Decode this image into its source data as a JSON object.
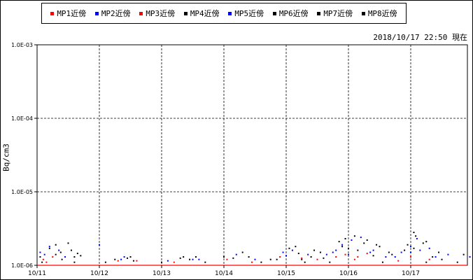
{
  "legend": [
    {
      "label": "MP1近傍",
      "color": "#ff0000"
    },
    {
      "label": "MP2近傍",
      "color": "#0000ff"
    },
    {
      "label": "MP3近傍",
      "color": "#ff0000"
    },
    {
      "label": "MP4近傍",
      "color": "#000000"
    },
    {
      "label": "MP5近傍",
      "color": "#0000ff"
    },
    {
      "label": "MP6近傍",
      "color": "#000000"
    },
    {
      "label": "MP7近傍",
      "color": "#000000"
    },
    {
      "label": "MP8近傍",
      "color": "#000000"
    }
  ],
  "timestamp": "2018/10/17 22:50 現在",
  "chart_data": {
    "type": "scatter",
    "ylabel": "Bq/cm3",
    "yscale": "log",
    "ylim": [
      1e-06,
      0.001
    ],
    "y_tick_labels": [
      "1.0E-03",
      "1.0E-04",
      "1.0E-05",
      "1.0E-06"
    ],
    "x_tick_labels": [
      "10/11",
      "10/12",
      "10/13",
      "10/14",
      "10/15",
      "10/16",
      "10/17"
    ],
    "xlim_days": [
      0,
      7.0
    ],
    "grid": true,
    "baseline_color": "#ff0000",
    "series": [
      {
        "name": "MP1近傍",
        "color": "#ff0000",
        "points": [
          [
            0.1,
            1.2e-06
          ],
          [
            0.25,
            1.3e-06
          ],
          [
            1.3,
            1.15e-06
          ],
          [
            2.2,
            1.1e-06
          ],
          [
            3.05,
            1.2e-06
          ],
          [
            3.9,
            1.3e-06
          ],
          [
            4.25,
            1.25e-06
          ],
          [
            4.8,
            1.3e-06
          ],
          [
            4.95,
            1.4e-06
          ],
          [
            5.15,
            1.3e-06
          ],
          [
            5.3,
            1.45e-06
          ],
          [
            6.0,
            1.3e-06
          ],
          [
            6.3,
            1.2e-06
          ]
        ]
      },
      {
        "name": "MP2近傍",
        "color": "#0000ff",
        "points": [
          [
            0.05,
            1.5e-06
          ],
          [
            0.2,
            1.8e-06
          ],
          [
            0.35,
            1.6e-06
          ],
          [
            1.0,
            1.9e-06
          ],
          [
            1.4,
            1.3e-06
          ],
          [
            2.5,
            1.2e-06
          ],
          [
            3.2,
            1.4e-06
          ],
          [
            3.95,
            1.5e-06
          ],
          [
            4.1,
            1.6e-06
          ],
          [
            4.35,
            1.4e-06
          ],
          [
            4.75,
            1.5e-06
          ],
          [
            4.9,
            1.9e-06
          ],
          [
            5.05,
            2.2e-06
          ],
          [
            5.2,
            2.4e-06
          ],
          [
            5.4,
            1.6e-06
          ],
          [
            5.6,
            1.3e-06
          ],
          [
            5.85,
            1.5e-06
          ],
          [
            6.0,
            1.8e-06
          ],
          [
            6.1,
            2.3e-06
          ],
          [
            6.3,
            1.7e-06
          ],
          [
            6.6,
            1.4e-06
          ],
          [
            6.95,
            1.3e-06
          ]
        ]
      },
      {
        "name": "MP3近傍",
        "color": "#ff0000",
        "points": [
          [
            0.15,
            1.1e-06
          ],
          [
            1.6,
            1.15e-06
          ],
          [
            3.45,
            1.1e-06
          ],
          [
            4.5,
            1.2e-06
          ],
          [
            5.1,
            1.2e-06
          ],
          [
            5.8,
            1.15e-06
          ]
        ]
      },
      {
        "name": "MP4近傍",
        "color": "#000000",
        "points": [
          [
            0.05,
            1.3e-06
          ],
          [
            0.3,
            1.4e-06
          ],
          [
            0.4,
            1.2e-06
          ],
          [
            0.55,
            1.6e-06
          ],
          [
            0.7,
            1.35e-06
          ],
          [
            1.25,
            1.2e-06
          ],
          [
            1.5,
            1.3e-06
          ],
          [
            2.3,
            1.25e-06
          ],
          [
            2.45,
            1.2e-06
          ],
          [
            3.0,
            1.3e-06
          ],
          [
            3.3,
            1.5e-06
          ],
          [
            3.75,
            1.2e-06
          ],
          [
            4.05,
            1.7e-06
          ],
          [
            4.2,
            1.45e-06
          ],
          [
            4.4,
            1.3e-06
          ],
          [
            4.6,
            1.25e-06
          ],
          [
            4.85,
            2.1e-06
          ],
          [
            5.0,
            1.7e-06
          ],
          [
            5.25,
            2e-06
          ],
          [
            5.5,
            1.8e-06
          ],
          [
            5.9,
            1.6e-06
          ],
          [
            6.05,
            2.8e-06
          ],
          [
            6.2,
            2e-06
          ],
          [
            6.5,
            1.2e-06
          ],
          [
            6.85,
            1.4e-06
          ]
        ]
      },
      {
        "name": "MP5近傍",
        "color": "#0000ff",
        "points": [
          [
            0.12,
            1.4e-06
          ],
          [
            0.45,
            1.3e-06
          ],
          [
            1.35,
            1.2e-06
          ],
          [
            2.1,
            1.15e-06
          ],
          [
            2.6,
            1.2e-06
          ],
          [
            3.5,
            1.2e-06
          ],
          [
            4.0,
            1.35e-06
          ],
          [
            4.65,
            1.4e-06
          ],
          [
            4.8,
            1.6e-06
          ],
          [
            5.0,
            1.4e-06
          ],
          [
            5.35,
            1.5e-06
          ],
          [
            5.75,
            1.3e-06
          ],
          [
            6.0,
            1.5e-06
          ],
          [
            6.15,
            1.6e-06
          ],
          [
            6.4,
            1.3e-06
          ]
        ]
      },
      {
        "name": "MP6近傍",
        "color": "#000000",
        "points": [
          [
            0.08,
            1.1e-06
          ],
          [
            0.6,
            1.1e-06
          ],
          [
            1.1,
            1.1e-06
          ],
          [
            2.0,
            1.1e-06
          ],
          [
            2.7,
            1.1e-06
          ],
          [
            3.6,
            1.1e-06
          ],
          [
            4.3,
            1.1e-06
          ],
          [
            4.7,
            1.1e-06
          ],
          [
            5.55,
            1.1e-06
          ],
          [
            6.25,
            1.1e-06
          ],
          [
            6.75,
            1.1e-06
          ]
        ]
      },
      {
        "name": "MP7近傍",
        "color": "#000000",
        "points": [
          [
            0.3,
            1.9e-06
          ],
          [
            0.5,
            2e-06
          ],
          [
            0.65,
            1.45e-06
          ],
          [
            1.45,
            1.25e-06
          ],
          [
            2.35,
            1.3e-06
          ],
          [
            3.15,
            1.25e-06
          ],
          [
            3.85,
            1.2e-06
          ],
          [
            4.15,
            1.8e-06
          ],
          [
            4.45,
            1.6e-06
          ],
          [
            4.95,
            2.3e-06
          ],
          [
            5.1,
            2.5e-06
          ],
          [
            5.3,
            2.2e-06
          ],
          [
            5.45,
            1.9e-06
          ],
          [
            5.65,
            1.5e-06
          ],
          [
            5.95,
            1.9e-06
          ],
          [
            6.08,
            2.5e-06
          ],
          [
            6.25,
            2.1e-06
          ],
          [
            6.45,
            1.5e-06
          ]
        ]
      },
      {
        "name": "MP8近傍",
        "color": "#000000",
        "points": [
          [
            0.2,
            1.7e-06
          ],
          [
            0.38,
            1.5e-06
          ],
          [
            0.6,
            1.3e-06
          ],
          [
            1.55,
            1.15e-06
          ],
          [
            2.55,
            1.3e-06
          ],
          [
            3.4,
            1.3e-06
          ],
          [
            4.25,
            1.2e-06
          ],
          [
            4.55,
            1.5e-06
          ],
          [
            4.9,
            1.8e-06
          ],
          [
            5.15,
            1.6e-06
          ],
          [
            5.4,
            1.35e-06
          ],
          [
            5.7,
            1.4e-06
          ],
          [
            6.05,
            1.7e-06
          ],
          [
            6.35,
            1.3e-06
          ]
        ]
      }
    ]
  }
}
